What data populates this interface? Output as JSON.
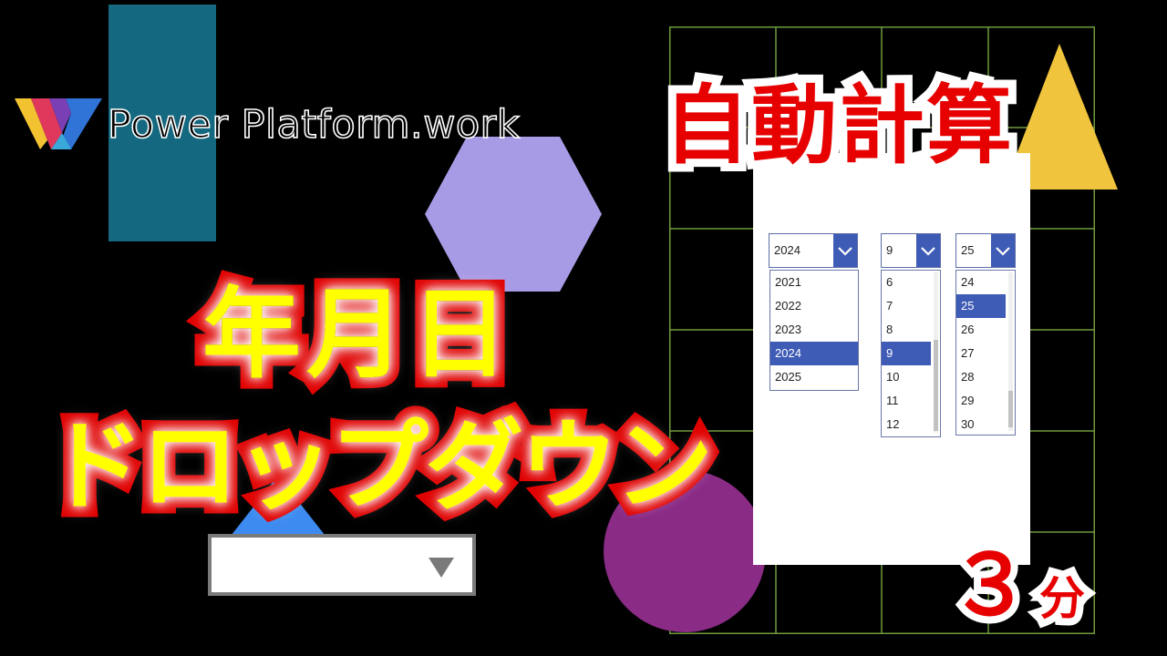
{
  "brand": {
    "name": "Power Platform.work"
  },
  "title": {
    "line1": "年月日",
    "line2": "ドロップダウン"
  },
  "badges": {
    "top": "自動計算",
    "duration_number": "３",
    "duration_unit": "分"
  },
  "colors": {
    "teal": "#14687f",
    "lavender": "#a89be6",
    "purple": "#8a2b86",
    "yellow": "#f0c43c",
    "blue": "#3d8bf0",
    "grid": "#6f9b3c",
    "title_fill": "#ffff00",
    "title_stroke": "#e00000",
    "accent_red": "#e60000",
    "dropdown_accent": "#3e5bb5"
  },
  "year_dropdown": {
    "selected": "2024",
    "options": [
      "2021",
      "2022",
      "2023",
      "2024",
      "2025"
    ]
  },
  "month_dropdown": {
    "selected": "9",
    "options": [
      "6",
      "7",
      "8",
      "9",
      "10",
      "11",
      "12"
    ]
  },
  "day_dropdown": {
    "selected": "25",
    "options": [
      "24",
      "25",
      "26",
      "27",
      "28",
      "29",
      "30"
    ]
  },
  "icons": {
    "logo": "power-platform-logo-icon",
    "dropdown_chevron": "chevron-down-icon",
    "big_dropdown_caret": "caret-down-icon"
  }
}
